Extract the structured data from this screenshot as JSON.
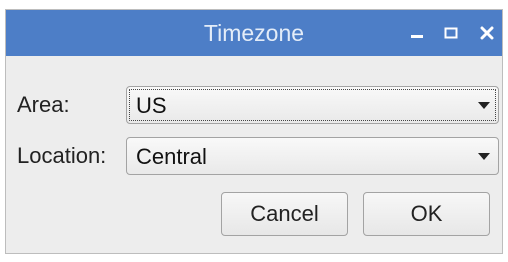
{
  "window": {
    "title": "Timezone",
    "controls": {
      "minimize_icon": "minimize-icon",
      "maximize_icon": "maximize-icon",
      "close_icon": "close-icon"
    },
    "titlebar_color": "#4d7ec7"
  },
  "form": {
    "area_label": "Area:",
    "area_value": "US",
    "location_label": "Location:",
    "location_value": "Central"
  },
  "buttons": {
    "cancel_label": "Cancel",
    "ok_label": "OK"
  }
}
